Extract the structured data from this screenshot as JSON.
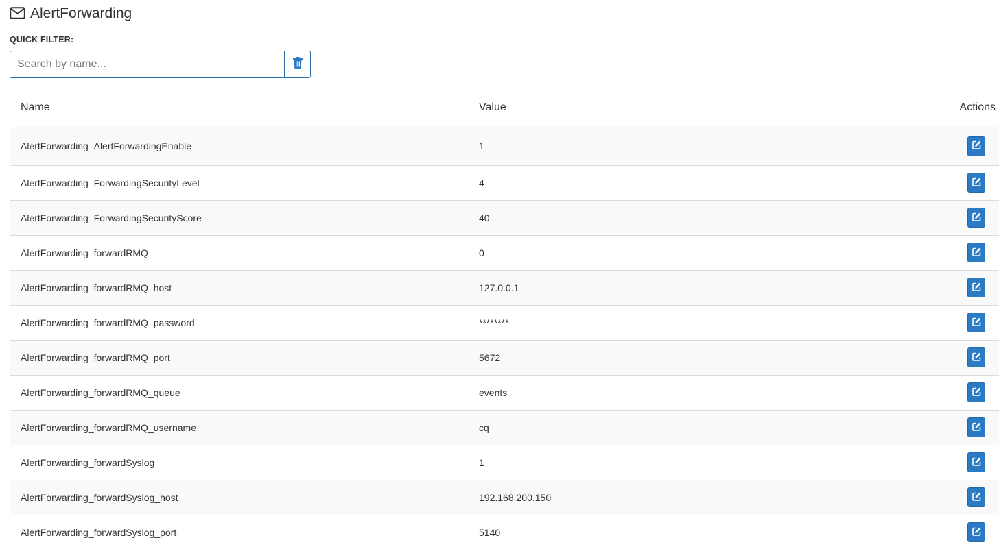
{
  "header": {
    "title": "AlertForwarding",
    "icon": "envelope-icon"
  },
  "filter": {
    "label": "QUICK FILTER:",
    "placeholder": "Search by name...",
    "value": "",
    "clear_icon": "trash-icon"
  },
  "table": {
    "columns": {
      "name": "Name",
      "value": "Value",
      "actions": "Actions"
    },
    "rows": [
      {
        "name": "AlertForwarding_AlertForwardingEnable",
        "value": "1"
      },
      {
        "name": "AlertForwarding_ForwardingSecurityLevel",
        "value": "4"
      },
      {
        "name": "AlertForwarding_ForwardingSecurityScore",
        "value": "40"
      },
      {
        "name": "AlertForwarding_forwardRMQ",
        "value": "0"
      },
      {
        "name": "AlertForwarding_forwardRMQ_host",
        "value": "127.0.0.1"
      },
      {
        "name": "AlertForwarding_forwardRMQ_password",
        "value": "********"
      },
      {
        "name": "AlertForwarding_forwardRMQ_port",
        "value": "5672"
      },
      {
        "name": "AlertForwarding_forwardRMQ_queue",
        "value": "events"
      },
      {
        "name": "AlertForwarding_forwardRMQ_username",
        "value": "cq"
      },
      {
        "name": "AlertForwarding_forwardSyslog",
        "value": "1"
      },
      {
        "name": "AlertForwarding_forwardSyslog_host",
        "value": "192.168.200.150"
      },
      {
        "name": "AlertForwarding_forwardSyslog_port",
        "value": "5140"
      }
    ],
    "edit_icon": "edit-icon"
  },
  "colors": {
    "accent": "#2b7bc4",
    "border": "#2a6fa8",
    "stripe": "#f9f9f9"
  }
}
